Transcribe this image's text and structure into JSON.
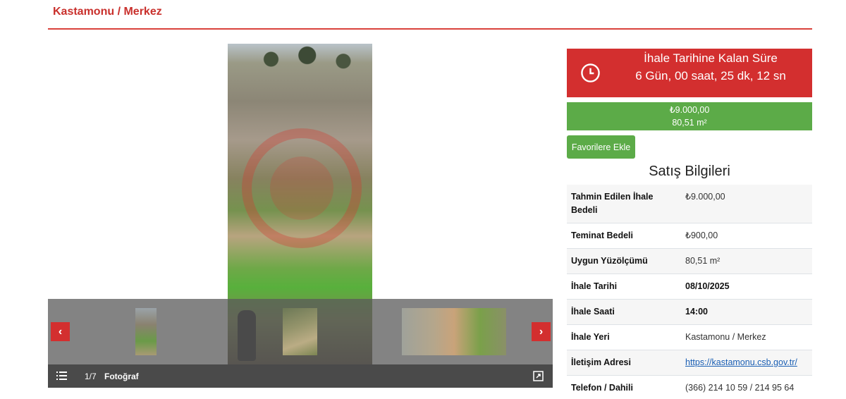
{
  "breadcrumb": "Kastamonu / Merkez",
  "colors": {
    "accent": "#d32f2f",
    "success": "#5cab48"
  },
  "gallery": {
    "counter": "1/7",
    "caption": "Fotoğraf",
    "prev_symbol": "‹",
    "next_symbol": "›"
  },
  "countdown": {
    "title": "İhale Tarihine Kalan Süre",
    "value": "6 Gün, 00 saat, 25 dk, 12 sn"
  },
  "price": {
    "amount": "₺9.000,00",
    "area": "80,51 m²"
  },
  "favorites_button": "Favorilere Ekle",
  "sales_info": {
    "title": "Satış Bilgileri",
    "rows": [
      {
        "label": "Tahmin Edilen İhale Bedeli",
        "value": "₺9.000,00"
      },
      {
        "label": "Teminat Bedeli",
        "value": "₺900,00"
      },
      {
        "label": "Uygun Yüzölçümü",
        "value": "80,51 m²"
      },
      {
        "label": "İhale Tarihi",
        "value": "08/10/2025"
      },
      {
        "label": "İhale Saati",
        "value": "14:00"
      },
      {
        "label": "İhale Yeri",
        "value": "Kastamonu / Merkez"
      },
      {
        "label": "İletişim Adresi",
        "value": "https://kastamonu.csb.gov.tr/"
      },
      {
        "label": "Telefon / Dahili",
        "value": "(366) 214 10 59 / 214 95 64"
      }
    ]
  }
}
